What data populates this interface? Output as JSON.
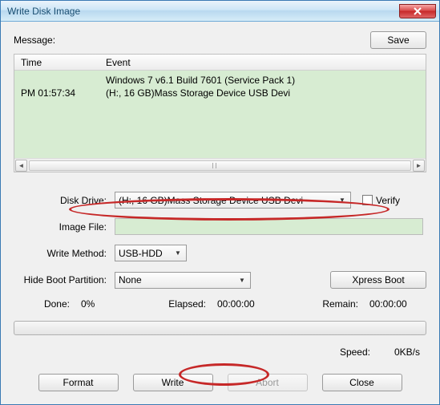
{
  "window": {
    "title": "Write Disk Image"
  },
  "labels": {
    "message": "Message:",
    "time_col": "Time",
    "event_col": "Event",
    "disk_drive": "Disk Drive:",
    "image_file": "Image File:",
    "write_method": "Write Method:",
    "hide_boot": "Hide Boot Partition:",
    "verify": "Verify",
    "done": "Done:",
    "elapsed": "Elapsed:",
    "remain": "Remain:",
    "speed": "Speed:"
  },
  "buttons": {
    "save": "Save",
    "xpress_boot": "Xpress Boot",
    "format": "Format",
    "write": "Write",
    "abort": "Abort",
    "close": "Close"
  },
  "messages": {
    "rows": [
      {
        "time": "",
        "event": "Windows 7 v6.1 Build 7601 (Service Pack 1)"
      },
      {
        "time": "PM 01:57:34",
        "event": "(H:, 16 GB)Mass Storage Device USB Devi"
      }
    ]
  },
  "fields": {
    "disk_drive_value": "(H:, 16 GB)Mass Storage Device USB Devi",
    "image_file_value": "",
    "write_method_value": "USB-HDD",
    "hide_boot_value": "None",
    "verify_checked": false
  },
  "stats": {
    "done_pct": "0%",
    "elapsed_time": "00:00:00",
    "remain_time": "00:00:00",
    "speed_value": "0KB/s"
  }
}
